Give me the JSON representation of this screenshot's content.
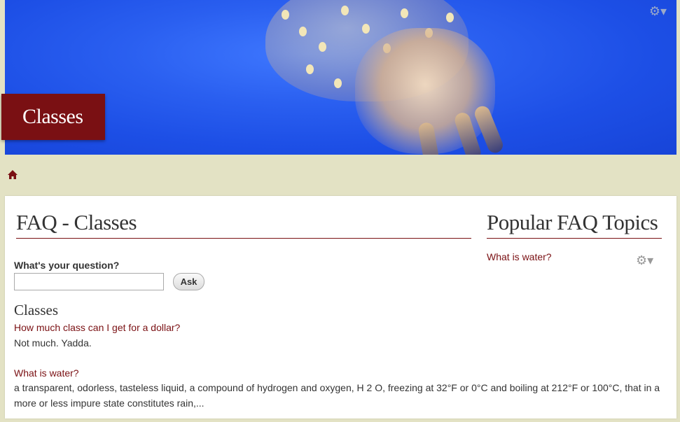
{
  "banner": {
    "title": "Classes"
  },
  "breadcrumb": {
    "home_icon": "home-icon"
  },
  "main": {
    "title": "FAQ - Classes",
    "question_label": "What's your question?",
    "question_value": "",
    "ask_label": "Ask",
    "section_title": "Classes",
    "faqs": [
      {
        "question": "How much class can I get for a dollar?",
        "answer": "Not much. Yadda."
      },
      {
        "question": "What is water?",
        "answer": "a transparent, odorless, tasteless liquid, a compound of hydrogen and oxygen, H 2 O, freezing at 32°F or 0°C and boiling at 212°F or 100°C, that in a more or less impure state constitutes rain,..."
      }
    ]
  },
  "sidebar": {
    "title": "Popular FAQ Topics",
    "links": [
      "What is water?"
    ]
  },
  "colors": {
    "accent": "#7a1013",
    "background": "#e3e2c4",
    "banner_blue": "#2a5ff0"
  }
}
